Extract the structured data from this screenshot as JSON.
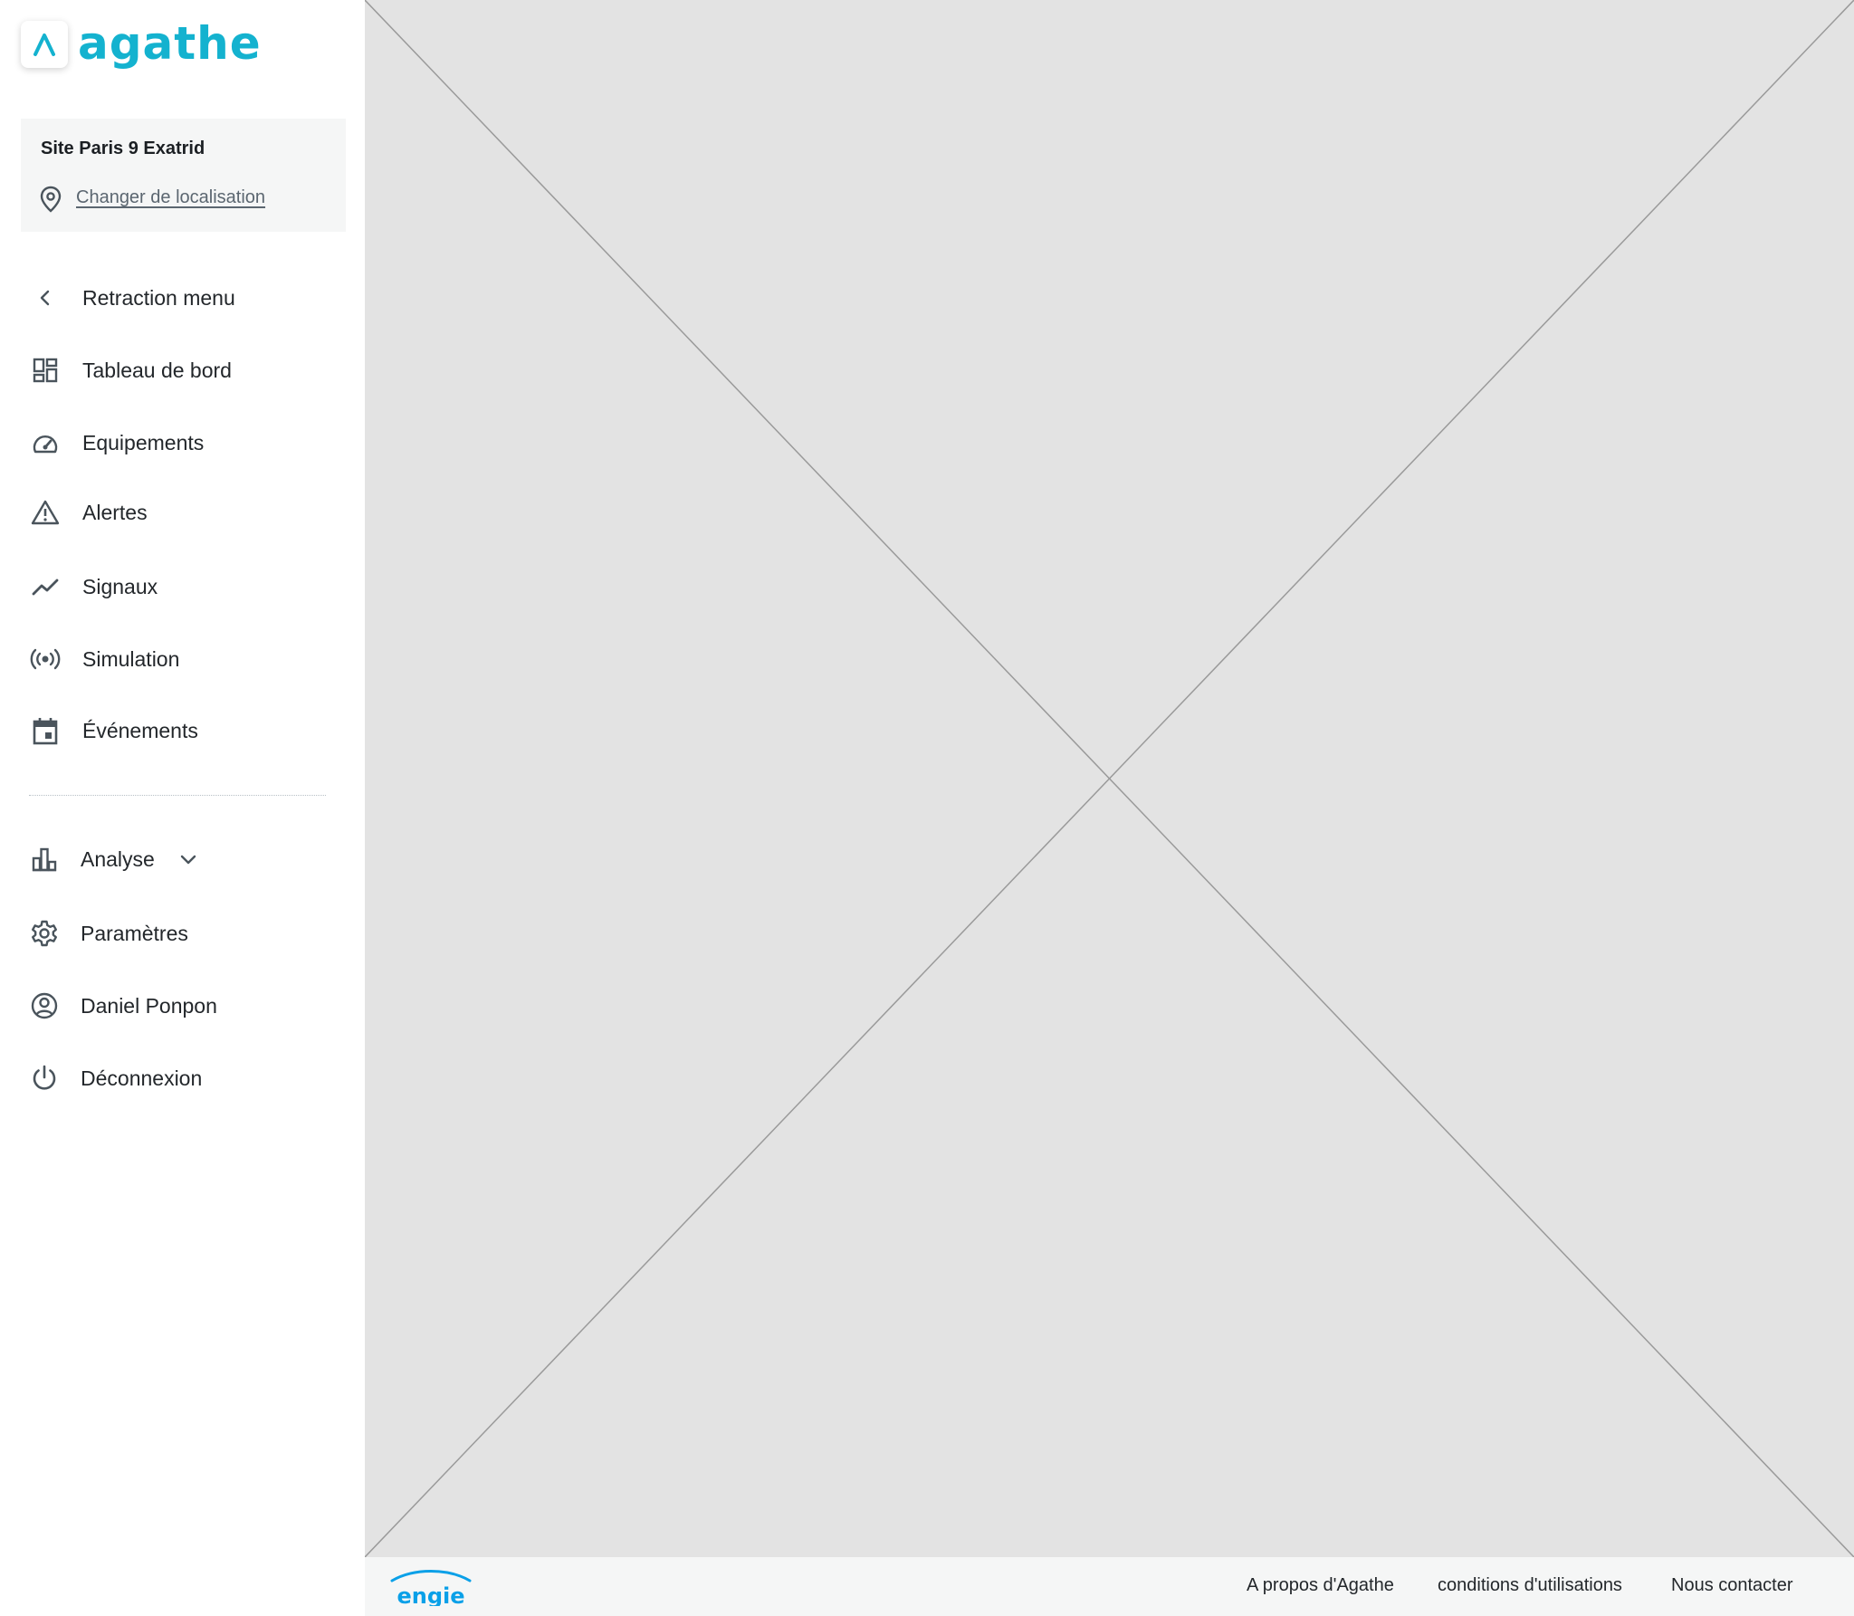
{
  "brand": {
    "name": "agathe",
    "color": "#14b2cf"
  },
  "site": {
    "name": "Site Paris 9 Exatrid",
    "change_location_label": "Changer de localisation"
  },
  "nav": {
    "retraction": "Retraction menu",
    "dashboard": "Tableau de bord",
    "equipments": "Equipements",
    "alerts": "Alertes",
    "signals": "Signaux",
    "simulation": "Simulation",
    "events": "Événements",
    "analysis": "Analyse",
    "settings": "Paramètres",
    "user": "Daniel Ponpon",
    "logout": "Déconnexion"
  },
  "footer": {
    "brand": "engie",
    "about": "A propos d'Agathe",
    "terms": "conditions d'utilisations",
    "contact": "Nous contacter"
  },
  "colors": {
    "text": "#23272b",
    "icon": "#4a545c",
    "placeholder_bg": "#e3e3e3",
    "engie_blue": "#0aa0e8"
  },
  "icons": [
    "agathe-logo-icon",
    "location-pin-icon",
    "chevron-left-icon",
    "dashboard-icon",
    "gauge-icon",
    "warning-icon",
    "trend-icon",
    "broadcast-icon",
    "calendar-icon",
    "bar-chart-icon",
    "chevron-down-icon",
    "gear-icon",
    "account-circle-icon",
    "power-icon"
  ]
}
